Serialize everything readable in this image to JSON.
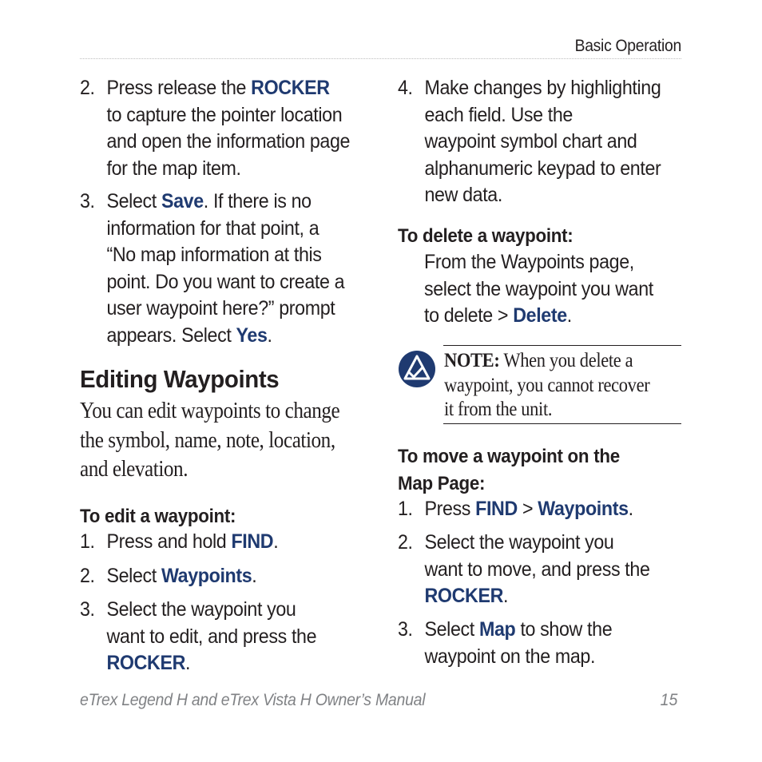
{
  "header": {
    "section_title": "Basic Operation"
  },
  "left_column": {
    "capture_steps": [
      {
        "number": "2.",
        "lines": [
          {
            "pre": "Press release the ",
            "hl": "ROCKER",
            "post": ""
          },
          {
            "pre": "to capture the pointer location",
            "hl": "",
            "post": ""
          },
          {
            "pre": "and open the information page",
            "hl": "",
            "post": ""
          },
          {
            "pre": "for the map item.",
            "hl": "",
            "post": ""
          }
        ]
      },
      {
        "number": "3.",
        "lines": [
          {
            "pre": "Select ",
            "hl": "Save",
            "post": ". If there is no"
          },
          {
            "pre": "information for that point, a",
            "hl": "",
            "post": ""
          },
          {
            "pre": "“No map information at this",
            "hl": "",
            "post": ""
          },
          {
            "pre": "point. Do you want to create a",
            "hl": "",
            "post": ""
          },
          {
            "pre": "user waypoint here?” prompt",
            "hl": "",
            "post": ""
          },
          {
            "pre": "appears. Select ",
            "hl": "Yes",
            "post": "."
          }
        ]
      }
    ],
    "section_heading": "Editing Waypoints",
    "intro_lines": [
      "You can edit waypoints to change",
      "the symbol, name, note, location,",
      "and elevation."
    ],
    "edit_procedure": {
      "heading": "To edit a waypoint:",
      "steps": [
        {
          "number": "1.",
          "lines": [
            {
              "pre": "Press and hold ",
              "hl": "FIND",
              "post": "."
            }
          ]
        },
        {
          "number": "2.",
          "lines": [
            {
              "pre": "Select ",
              "hl": "Waypoints",
              "post": "."
            }
          ]
        },
        {
          "number": "3.",
          "lines": [
            {
              "pre": "Select the waypoint you",
              "hl": "",
              "post": ""
            },
            {
              "pre": "want to edit, and press the",
              "hl": "",
              "post": ""
            },
            {
              "pre": "",
              "hl": "ROCKER",
              "post": "."
            }
          ]
        }
      ]
    }
  },
  "right_column": {
    "edit_step_4": {
      "number": "4.",
      "lines": [
        {
          "pre": "Make changes by highlighting",
          "hl": "",
          "post": ""
        },
        {
          "pre": "each field. Use the",
          "hl": "",
          "post": ""
        },
        {
          "pre": "waypoint symbol chart and",
          "hl": "",
          "post": ""
        },
        {
          "pre": "alphanumeric keypad to enter",
          "hl": "",
          "post": ""
        },
        {
          "pre": "new data.",
          "hl": "",
          "post": ""
        }
      ]
    },
    "delete_procedure": {
      "heading": "To delete a waypoint:",
      "lines": [
        {
          "pre": "From the Waypoints page,",
          "hl": "",
          "post": ""
        },
        {
          "pre": "select the waypoint you want",
          "hl": "",
          "post": ""
        },
        {
          "pre": "to delete > ",
          "hl": "Delete",
          "post": "."
        }
      ]
    },
    "note": {
      "icon": "note-triangle-check-icon",
      "label": "NOTE:",
      "lines": [
        " When you delete a",
        "waypoint, you cannot recover",
        "it from the unit."
      ]
    },
    "move_procedure": {
      "heading_lines": [
        "To move a waypoint on the",
        "Map Page:"
      ],
      "steps": [
        {
          "number": "1.",
          "lines": [
            {
              "pre": "Press ",
              "hl": "FIND",
              "post": " > ",
              "hl2": "Waypoints",
              "post2": "."
            }
          ]
        },
        {
          "number": "2.",
          "lines": [
            {
              "pre": "Select the waypoint you",
              "hl": "",
              "post": ""
            },
            {
              "pre": "want to move, and press the",
              "hl": "",
              "post": ""
            },
            {
              "pre": "",
              "hl": "ROCKER",
              "post": "."
            }
          ]
        },
        {
          "number": "3.",
          "lines": [
            {
              "pre": "Select ",
              "hl": "Map",
              "post": " to show the"
            },
            {
              "pre": "waypoint on the map.",
              "hl": "",
              "post": ""
            }
          ]
        }
      ]
    }
  },
  "footer": {
    "manual_title": "eTrex Legend H and eTrex Vista H Owner’s Manual",
    "page_number": "15"
  },
  "colors": {
    "highlight": "#1f3a70",
    "text": "#231f20",
    "footer": "#808285",
    "note_icon": "#1f3a70"
  }
}
